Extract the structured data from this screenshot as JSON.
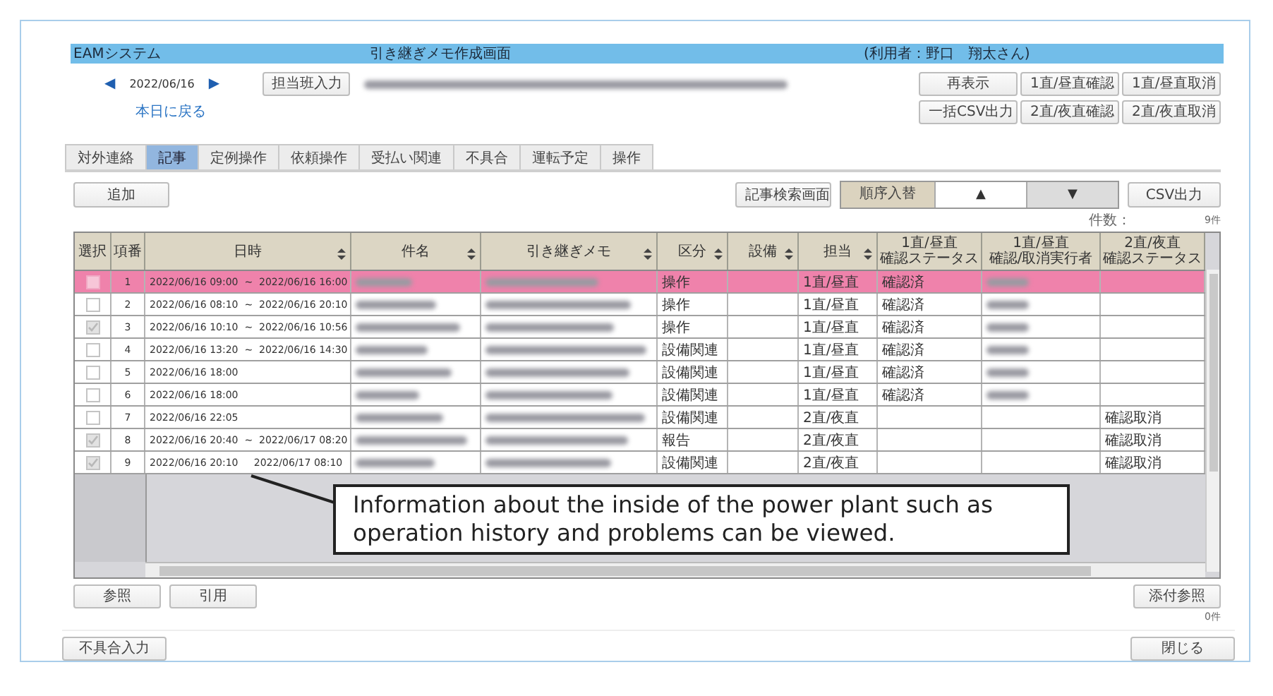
{
  "window": {
    "app_name": "EAMシステム",
    "title": "引き継ぎメモ作成画面",
    "user": "(利用者：野口　翔太さん)"
  },
  "date_nav": {
    "prev": "◀",
    "date": "2022/06/16",
    "next": "▶",
    "today_link": "本日に戻る"
  },
  "shift_input_button": "担当班入力",
  "action_buttons": [
    "再表示",
    "1直/昼直確認",
    "1直/昼直取消",
    "一括CSV出力",
    "2直/夜直確認",
    "2直/夜直取消"
  ],
  "tabs": [
    {
      "label": "対外連絡",
      "selected": false
    },
    {
      "label": "記事",
      "selected": true
    },
    {
      "label": "定例操作",
      "selected": false
    },
    {
      "label": "依頼操作",
      "selected": false
    },
    {
      "label": "受払い関連",
      "selected": false
    },
    {
      "label": "不具合",
      "selected": false
    },
    {
      "label": "運転予定",
      "selected": false
    },
    {
      "label": "操作",
      "selected": false
    }
  ],
  "toolbar": {
    "add": "追加",
    "search": "記事検索画面",
    "reorder_label": "順序入替",
    "order_buttons": [
      {
        "label": "▲",
        "selected": false
      },
      {
        "label": "▼",
        "selected": true
      }
    ],
    "csv": "CSV出力"
  },
  "count": {
    "label": "件数：",
    "value": "9件"
  },
  "table": {
    "columns": [
      {
        "label": "選択",
        "sortable": false
      },
      {
        "label": "項番",
        "sortable": false
      },
      {
        "label": "日時",
        "sortable": true
      },
      {
        "label": "件名",
        "sortable": true
      },
      {
        "label": "引き継ぎメモ",
        "sortable": true
      },
      {
        "label": "区分",
        "sortable": true
      },
      {
        "label": "設備",
        "sortable": true
      },
      {
        "label": "担当",
        "sortable": true
      },
      {
        "label_lines": [
          "1直/昼直",
          "確認ステータス"
        ],
        "sortable": false
      },
      {
        "label_lines": [
          "1直/昼直",
          "確認/取消実行者"
        ],
        "sortable": false
      },
      {
        "label_lines": [
          "2直/夜直",
          "確認ステータス"
        ],
        "sortable": false
      }
    ],
    "rows": [
      {
        "selected": true,
        "checked": false,
        "number": "1",
        "datetime": "2022/06/16 09:00  ~  2022/06/16 16:00",
        "category": "操作",
        "shift": "1直/昼直",
        "status_1": "確認済",
        "confirmer_redacted": true
      },
      {
        "selected": false,
        "checked": false,
        "number": "2",
        "datetime": "2022/06/16 08:10  ~  2022/06/16 20:10",
        "category": "操作",
        "shift": "1直/昼直",
        "status_1": "確認済",
        "confirmer_redacted": true
      },
      {
        "selected": false,
        "checked": true,
        "number": "3",
        "datetime": "2022/06/16 10:10  ~  2022/06/16 10:56",
        "category": "操作",
        "shift": "1直/昼直",
        "status_1": "確認済",
        "confirmer_redacted": true
      },
      {
        "selected": false,
        "checked": false,
        "number": "4",
        "datetime": "2022/06/16 13:20  ~  2022/06/16 14:30",
        "category": "設備関連",
        "shift": "1直/昼直",
        "status_1": "確認済",
        "confirmer_redacted": true
      },
      {
        "selected": false,
        "checked": false,
        "number": "5",
        "datetime": "2022/06/16 18:00",
        "category": "設備関連",
        "shift": "1直/昼直",
        "status_1": "確認済",
        "confirmer_redacted": true
      },
      {
        "selected": false,
        "checked": false,
        "number": "6",
        "datetime": "2022/06/16 18:00",
        "category": "設備関連",
        "shift": "1直/昼直",
        "status_1": "確認済",
        "confirmer_redacted": true
      },
      {
        "selected": false,
        "checked": false,
        "number": "7",
        "datetime": "2022/06/16 22:05",
        "category": "設備関連",
        "shift": "2直/夜直",
        "status_2": "確認取消",
        "confirmer_redacted": false
      },
      {
        "selected": false,
        "checked": true,
        "number": "8",
        "datetime": "2022/06/16 20:40  ~  2022/06/17 08:20",
        "category": "報告",
        "shift": "2直/夜直",
        "status_2": "確認取消",
        "confirmer_redacted": false
      },
      {
        "selected": false,
        "checked": true,
        "number": "9",
        "datetime": "2022/06/16 20:10     2022/06/17 08:10",
        "category": "設備関連",
        "shift": "2直/夜直",
        "status_2": "確認取消",
        "confirmer_redacted": false
      }
    ]
  },
  "callout": {
    "text": "Information about the inside of the power plant such as operation history and problems can be viewed."
  },
  "bottom": {
    "reference": "参照",
    "quote": "引用",
    "attachments": "添付参照",
    "attachment_count": "0件",
    "defect_input": "不具合入力",
    "close": "閉じる"
  }
}
